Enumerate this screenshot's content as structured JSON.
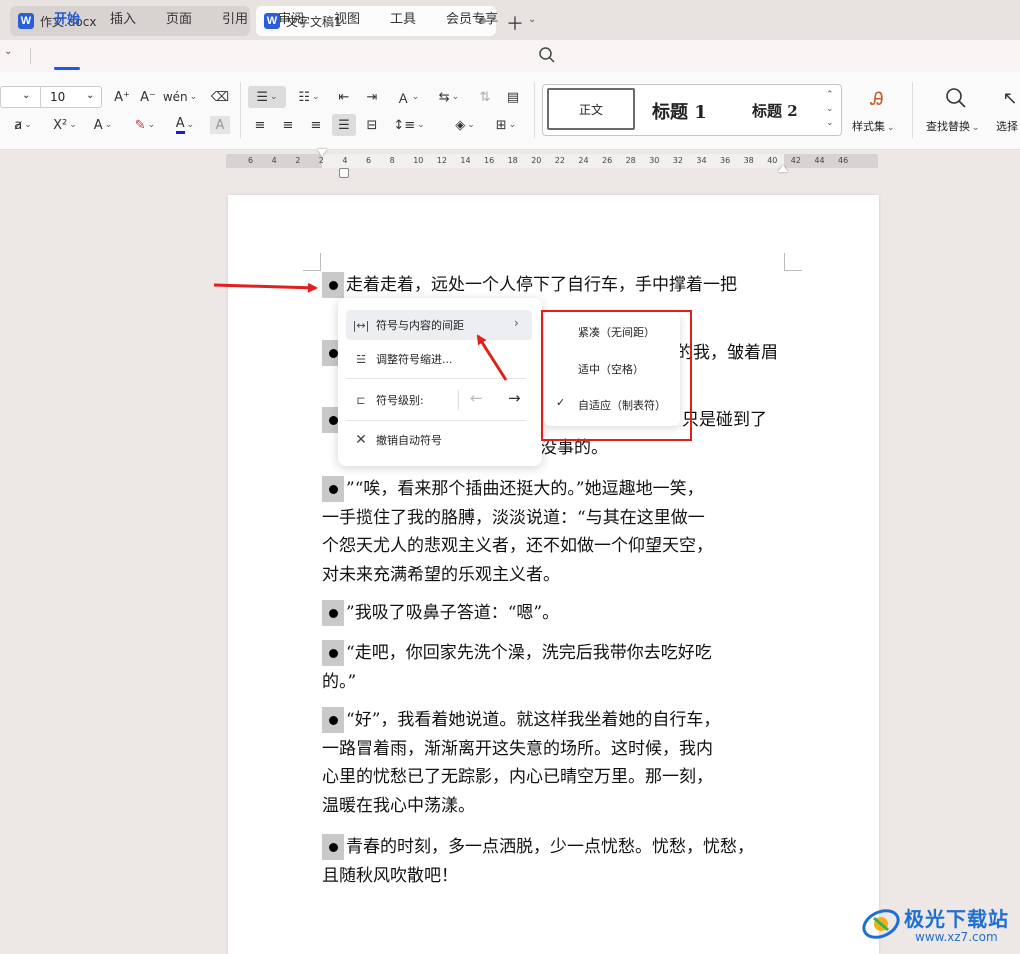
{
  "tabs": [
    {
      "label": "作文.docx",
      "icon": "W"
    },
    {
      "label": "文字文稿1",
      "icon": "W"
    }
  ],
  "menu": [
    "开始",
    "插入",
    "页面",
    "引用",
    "审阅",
    "视图",
    "工具",
    "会员专享"
  ],
  "ribbon": {
    "font_size": "10",
    "styles": {
      "normal": "正文",
      "h1": "标题 1",
      "h2": "标题 2"
    },
    "style_set_label": "样式集",
    "find_replace_label": "查找替换",
    "select_label": "选择"
  },
  "ruler_ticks": [
    "6",
    "4",
    "2",
    "2",
    "4",
    "6",
    "8",
    "10",
    "12",
    "14",
    "16",
    "18",
    "20",
    "22",
    "24",
    "26",
    "28",
    "30",
    "32",
    "34",
    "36",
    "38",
    "40",
    "42",
    "44",
    "46"
  ],
  "paragraphs": [
    {
      "lines": [
        "走着走着，远处一个人停下了自行车，手中撑着一把"
      ]
    },
    {
      "lines": [
        "的我，皱着眉"
      ]
    },
    {
      "lines": [
        "只是碰到了",
        "没事的。"
      ]
    },
    {
      "lines": [
        "”“唉，看来那个插曲还挺大的。”她逗趣地一笑，",
        "一手揽住了我的胳膊，淡淡说道：“与其在这里做一",
        "个怨天尤人的悲观主义者，还不如做一个仰望天空，",
        "对未来充满希望的乐观主义者。"
      ]
    },
    {
      "lines": [
        "”我吸了吸鼻子答道：“嗯”。"
      ]
    },
    {
      "lines": [
        "“走吧，你回家先洗个澡，洗完后我带你去吃好吃",
        "的。”"
      ]
    },
    {
      "lines": [
        "“好”，我看着她说道。就这样我坐着她的自行车，",
        "一路冒着雨，渐渐离开这失意的场所。这时候，我内",
        "心里的忧愁已了无踪影，内心已晴空万里。那一刻，",
        "温暖在我心中荡漾。"
      ]
    },
    {
      "lines": [
        "青春的时刻，多一点洒脱，少一点忧愁。忧愁，忧愁，",
        "且随秋风吹散吧！"
      ]
    }
  ],
  "context_menu": {
    "items": [
      "符号与内容的间距",
      "调整符号缩进...",
      "符号级别:",
      "撤销自动符号"
    ]
  },
  "submenu": {
    "items": [
      "紧凑（无间距）",
      "适中（空格）",
      "自适应（制表符）"
    ],
    "checked_index": 2
  },
  "watermark": {
    "name": "极光下载站",
    "url": "www.xz7.com"
  },
  "colors": {
    "accent": "#1f5bd6",
    "highlight_box": "#e0211b",
    "arrow": "#e0211b"
  }
}
